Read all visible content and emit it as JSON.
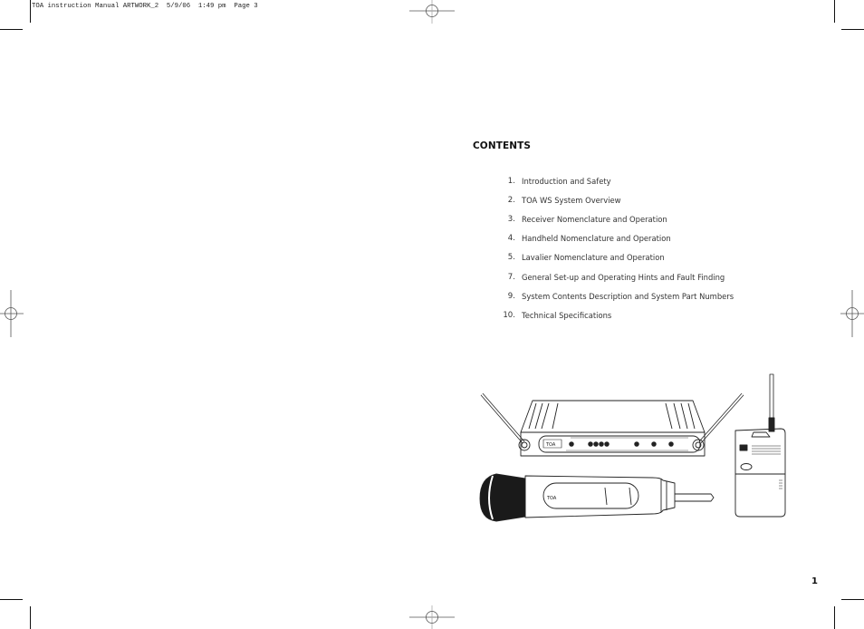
{
  "slug_line": "TOA instruction Manual ARTWORK_2  5/9/06  1:49 pm  Page 3",
  "contents": {
    "title": "CONTENTS",
    "items": [
      {
        "page": "1.",
        "label": "Introduction and Safety"
      },
      {
        "page": "2.",
        "label": "TOA WS System Overview"
      },
      {
        "page": "3.",
        "label": "Receiver Nomenclature and Operation"
      },
      {
        "page": "4.",
        "label": "Handheld Nomenclature and Operation"
      },
      {
        "page": "5.",
        "label": "Lavalier Nomenclature and Operation"
      },
      {
        "page": "7.",
        "label": "General Set-up and Operating Hints and Fault Finding"
      },
      {
        "page": "9.",
        "label": "System Contents Description and System Part Numbers"
      },
      {
        "page": "10.",
        "label": "Technical Specifications"
      }
    ]
  },
  "illustration": {
    "brand": "TOA",
    "items": [
      "wireless-receiver",
      "handheld-microphone",
      "bodypack-transmitter"
    ]
  },
  "page_number": "1"
}
